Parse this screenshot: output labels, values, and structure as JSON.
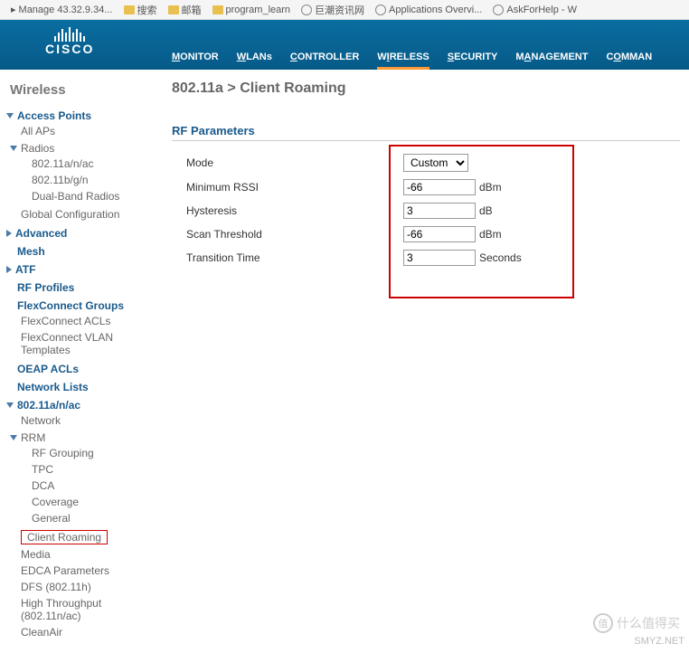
{
  "bookmarks": [
    {
      "icon": "arrow",
      "label": "Manage 43.32.9.34..."
    },
    {
      "icon": "folder",
      "label": "搜索"
    },
    {
      "icon": "folder",
      "label": "邮箱"
    },
    {
      "icon": "folder",
      "label": "program_learn"
    },
    {
      "icon": "globe",
      "label": "巨潮资讯网"
    },
    {
      "icon": "globe",
      "label": "Applications Overvi..."
    },
    {
      "icon": "globe",
      "label": "AskForHelp - W"
    }
  ],
  "logo": {
    "brand": "CISCO"
  },
  "nav": [
    {
      "key": "monitor",
      "label": "MONITOR",
      "u": "M"
    },
    {
      "key": "wlans",
      "label": "WLANs",
      "u": "W"
    },
    {
      "key": "controller",
      "label": "CONTROLLER",
      "u": "C"
    },
    {
      "key": "wireless",
      "label": "WIRELESS",
      "u": "W",
      "active": true
    },
    {
      "key": "security",
      "label": "SECURITY",
      "u": "S"
    },
    {
      "key": "management",
      "label": "MANAGEMENT",
      "u": "M"
    },
    {
      "key": "commands",
      "label": "COMMAN",
      "u": "C"
    }
  ],
  "sidebar": {
    "title": "Wireless",
    "access_points": {
      "label": "Access Points",
      "all_aps": "All APs",
      "radios": {
        "label": "Radios",
        "items": [
          "802.11a/n/ac",
          "802.11b/g/n",
          "Dual-Band Radios"
        ]
      },
      "global_config": "Global Configuration"
    },
    "advanced": "Advanced",
    "mesh": "Mesh",
    "atf": "ATF",
    "rf_profiles": "RF Profiles",
    "flexconnect": {
      "label": "FlexConnect Groups",
      "acls": "FlexConnect ACLs",
      "vlan": "FlexConnect VLAN Templates"
    },
    "oeap": "OEAP ACLs",
    "netlists": "Network Lists",
    "band_a": {
      "label": "802.11a/n/ac",
      "network": "Network",
      "rrm": {
        "label": "RRM",
        "items": [
          "RF Grouping",
          "TPC",
          "DCA",
          "Coverage",
          "General"
        ]
      },
      "client_roaming": "Client Roaming",
      "media": "Media",
      "edca": "EDCA Parameters",
      "dfs": "DFS (802.11h)",
      "ht": "High Throughput (802.11n/ac)",
      "cleanair": "CleanAir"
    }
  },
  "content": {
    "breadcrumb": "802.11a > Client Roaming",
    "section": "RF Parameters",
    "fields": {
      "mode": {
        "label": "Mode",
        "value": "Custom"
      },
      "min_rssi": {
        "label": "Minimum RSSI",
        "value": "-66",
        "unit": "dBm"
      },
      "hysteresis": {
        "label": "Hysteresis",
        "value": "3",
        "unit": "dB"
      },
      "scan_threshold": {
        "label": "Scan Threshold",
        "value": "-66",
        "unit": "dBm"
      },
      "transition_time": {
        "label": "Transition Time",
        "value": "3",
        "unit": "Seconds"
      }
    }
  },
  "watermark": {
    "en": "SMYZ.NET",
    "zh": "什么值得买"
  }
}
